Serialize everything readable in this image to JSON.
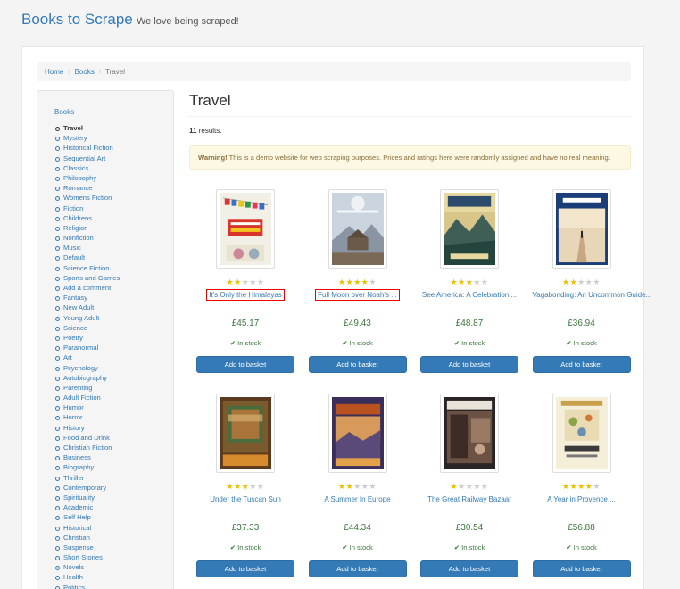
{
  "brand": {
    "title": "Books to Scrape",
    "tagline": "We love being scraped!"
  },
  "breadcrumb": {
    "home": "Home",
    "books": "Books",
    "current": "Travel"
  },
  "sidebar": {
    "root": "Books",
    "categories": [
      "Travel",
      "Mystery",
      "Historical Fiction",
      "Sequential Art",
      "Classics",
      "Philosophy",
      "Romance",
      "Womens Fiction",
      "Fiction",
      "Childrens",
      "Religion",
      "Nonfiction",
      "Music",
      "Default",
      "Science Fiction",
      "Sports and Games",
      "Add a comment",
      "Fantasy",
      "New Adult",
      "Young Adult",
      "Science",
      "Poetry",
      "Paranormal",
      "Art",
      "Psychology",
      "Autobiography",
      "Parenting",
      "Adult Fiction",
      "Humor",
      "Horror",
      "History",
      "Food and Drink",
      "Christian Fiction",
      "Business",
      "Biography",
      "Thriller",
      "Contemporary",
      "Spirituality",
      "Academic",
      "Self Help",
      "Historical",
      "Christian",
      "Suspense",
      "Short Stories",
      "Novels",
      "Health",
      "Politics"
    ]
  },
  "main": {
    "title": "Travel",
    "results_count": "11",
    "results_label": "results.",
    "warning_label": "Warning!",
    "warning_text": "This is a demo website for web scraping purposes. Prices and ratings here were randomly assigned and have no real meaning."
  },
  "books": [
    {
      "title": "It's Only the Himalayas",
      "price": "£45.17",
      "stock": "In stock",
      "rating": 2,
      "button": "Add to basket",
      "highlighted": true,
      "cover": "himalayas"
    },
    {
      "title": "Full Moon over Noah's ...",
      "price": "£49.43",
      "stock": "In stock",
      "rating": 4,
      "button": "Add to basket",
      "highlighted": true,
      "cover": "fullmoon"
    },
    {
      "title": "See America: A Celebration ...",
      "price": "£48.87",
      "stock": "In stock",
      "rating": 3,
      "button": "Add to basket",
      "highlighted": false,
      "cover": "seeamerica"
    },
    {
      "title": "Vagabonding: An Uncommon Guide...",
      "price": "£36.94",
      "stock": "In stock",
      "rating": 2,
      "button": "Add to basket",
      "highlighted": false,
      "cover": "vagabonding"
    },
    {
      "title": "Under the Tuscan Sun",
      "price": "£37.33",
      "stock": "In stock",
      "rating": 3,
      "button": "Add to basket",
      "highlighted": false,
      "cover": "tuscan"
    },
    {
      "title": "A Summer In Europe",
      "price": "£44.34",
      "stock": "In stock",
      "rating": 2,
      "button": "Add to basket",
      "highlighted": false,
      "cover": "europe"
    },
    {
      "title": "The Great Railway Bazaar",
      "price": "£30.54",
      "stock": "In stock",
      "rating": 1,
      "button": "Add to basket",
      "highlighted": false,
      "cover": "railway"
    },
    {
      "title": "A Year in Provence ...",
      "price": "£56.88",
      "stock": "In stock",
      "rating": 4,
      "button": "Add to basket",
      "highlighted": false,
      "cover": "provence"
    }
  ],
  "colors": {
    "link": "#337ab7",
    "price": "#3c763d",
    "star_on": "#e7c000",
    "star_off": "#cccccc",
    "highlight": "#ee0000"
  }
}
